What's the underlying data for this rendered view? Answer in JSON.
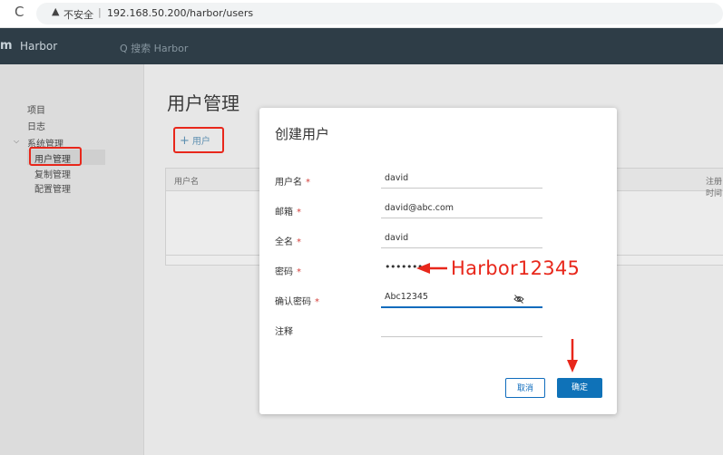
{
  "browser": {
    "reload_glyph": "C",
    "warning_glyph": "▲",
    "security_text": "不安全",
    "separator": "|",
    "url": "192.168.50.200/harbor/users"
  },
  "app": {
    "brand_glyph": "m",
    "brand": "Harbor",
    "search_placeholder": "Q 搜索 Harbor"
  },
  "sidebar": {
    "items": [
      {
        "label": "项目"
      },
      {
        "label": "日志"
      },
      {
        "label": "系统管理"
      },
      {
        "label": "用户管理"
      },
      {
        "label": "复制管理"
      },
      {
        "label": "配置管理"
      }
    ],
    "active": "用户管理"
  },
  "main": {
    "title": "用户管理",
    "add_user_plus": "+",
    "add_user_label": "用户",
    "columns": [
      "用户名",
      "注册时间"
    ]
  },
  "modal": {
    "title": "创建用户",
    "fields": [
      {
        "label": "用户名",
        "required_mark": "*",
        "value": "david"
      },
      {
        "label": "邮箱",
        "required_mark": "*",
        "value": "david@abc.com"
      },
      {
        "label": "全名",
        "required_mark": "*",
        "value": "david"
      },
      {
        "label": "密码",
        "required_mark": "*",
        "value": "••••••••"
      },
      {
        "label": "确认密码",
        "required_mark": "*",
        "value": "Abc12345"
      },
      {
        "label": "注释",
        "required_mark": "",
        "value": ""
      }
    ],
    "cancel_label": "取消",
    "ok_label": "确定"
  },
  "annotation": {
    "password_hint": "Harbor12345",
    "color": "#e8271b"
  }
}
